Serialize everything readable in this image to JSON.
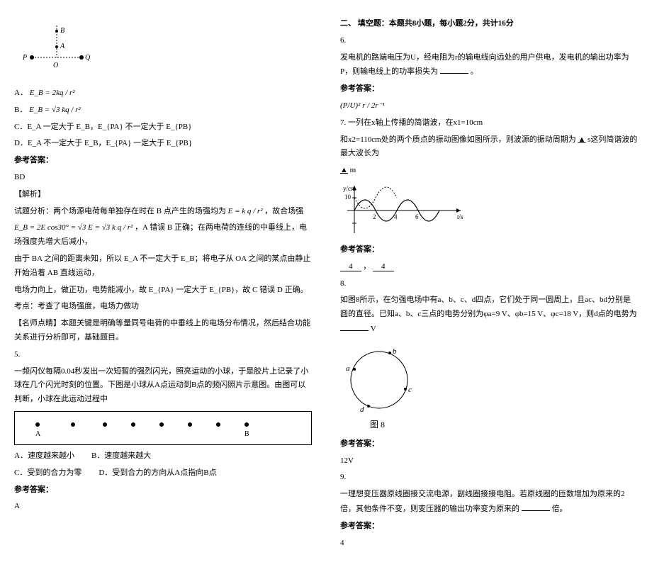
{
  "left": {
    "optA_prefix": "A．",
    "optA_formula": "E_B = 2kq / r²",
    "optB_prefix": "B．",
    "optB_formula": "E_B = √3 kq / r²",
    "optC": "C．E_A 一定大于 E_B，E_{PA} 不一定大于 E_{PB}",
    "optD": "D．E_A 不一定大于 E_B，E_{PA} 一定大于 E_{PB}",
    "ref_label": "参考答案：",
    "ref_ans": "BD",
    "jiexi": "【解析】",
    "line1_a": "试题分析：两个场源电荷每单独存在时在 B 点产生的场强均为 ",
    "line1_b": "E = k q / r²",
    "line1_c": "，故合场强",
    "line2_a": "E_B = 2E cos30° = √3 E = √3 k q / r²",
    "line2_b": "，A 错误 B 正确；在两电荷的连线的中垂线上，电场强度先增大后减小，",
    "line3": "由于 BA 之间的距离未知，所以 E_A 不一定大于 E_B；将电子从 OA 之间的某点由静止开始沿着 AB 直线运动，",
    "line4": "电场力向上，做正功，电势能减小，故 E_{PA} 一定大于 E_{PB}，故 C 错误 D 正确。",
    "kaodian": "考点：考查了电场强度，电场力做功",
    "mingshi": "【名师点睛】本题关键是明确等量同号电荷的中垂线上的电场分布情况，然后结合功能关系进行分析即可，基础题目。",
    "q5_num": "5.",
    "q5_p1": "一频闪仪每隔0.04秒发出一次短暂的强烈闪光，照亮运动的小球，于是胶片上记录了小球在几个闪光时刻的位置。下图是小球从A点运动到B点的频闪照片示意图。由图可以判断，小球在此运动过程中",
    "q5_a": "A．速度越来越小",
    "q5_b": "B．速度越来越大",
    "q5_c": "C．受到的合力为零",
    "q5_d": "D．受到合力的方向从A点指向B点",
    "q5_ref": "参考答案：",
    "q5_ans": "A"
  },
  "right": {
    "sec2": "二、 填空题：本题共8小题，每小题2分，共计16分",
    "q6_num": "6.",
    "q6_text_a": "发电机的路端电压为U，经电阻为r的输电线向远处的用户供电，发电机的输出功率为P，则输电线上的功率损失为",
    "q6_text_b": "。",
    "q6_ref": "参考答案：",
    "q6_ans": "(P/U)² r / 2r⁻¹",
    "q7_num": "7.",
    "q7_text_a": "一列在x轴上传播的简谐波，在x1=10cm",
    "q7_text_b": "和x2=110cm处的两个质点的振动图像如图所示，则波源的振动周期为",
    "q7_text_c": "▲",
    "q7_text_d": " s这列简谐波的最大波长为",
    "q7_text_e": "▲",
    "q7_text_f": " m",
    "q7_ref": "参考答案：",
    "q7_ans1": "4",
    "q7_sep": "，",
    "q7_ans2": "4",
    "q8_num": "8.",
    "q8_text_a": "如图8所示，在匀强电场中有a、b、c、d四点，它们处于同一圆周上，且ac、bd分别是圆的直径。已知a、b、c三点的电势分别为φa=9 V、φb=15 V、φc=18 V，则d点的电势为",
    "q8_text_b": " V",
    "q8_fig": "图 8",
    "q8_ref": "参考答案：",
    "q8_ans": "12V",
    "q9_num": "9.",
    "q9_text_a": "一理想变压器原线圈接交流电源，副线圈接接电阻。若原线圈的匝数增加为原来的2倍，其他条件不变，则变压器的输出功率变为原来的",
    "q9_text_b": "倍。",
    "q9_ref": "参考答案：",
    "q9_ans": "4"
  }
}
